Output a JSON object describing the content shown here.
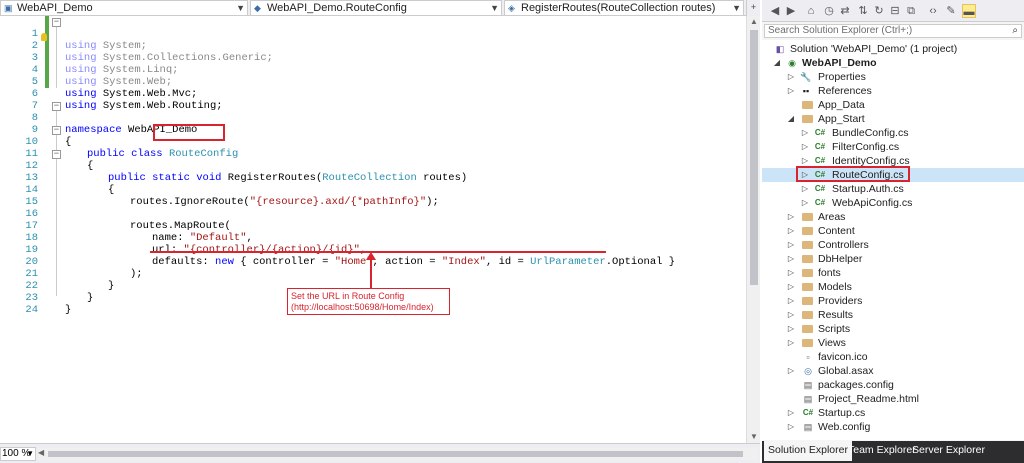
{
  "navbar": {
    "project": "WebAPI_Demo",
    "class": "WebAPI_Demo.RouteConfig",
    "member": "RegisterRoutes(RouteCollection routes)"
  },
  "code": {
    "lines": [
      {
        "n": "1"
      },
      {
        "n": "2"
      },
      {
        "n": "3"
      },
      {
        "n": "4"
      },
      {
        "n": "5"
      },
      {
        "n": "6"
      },
      {
        "n": "7"
      },
      {
        "n": "8"
      },
      {
        "n": "9"
      },
      {
        "n": "10"
      },
      {
        "n": "11"
      },
      {
        "n": "12"
      },
      {
        "n": "13"
      },
      {
        "n": "14"
      },
      {
        "n": "15"
      },
      {
        "n": "16"
      },
      {
        "n": "17"
      },
      {
        "n": "18"
      },
      {
        "n": "19"
      },
      {
        "n": "20"
      },
      {
        "n": "21"
      },
      {
        "n": "22"
      },
      {
        "n": "23"
      },
      {
        "n": "24"
      }
    ],
    "kw_using": "using",
    "ns1": "System;",
    "ns2": "System.Collections.Generic;",
    "ns3": "System.Linq;",
    "ns4": "System.Web;",
    "ns5": "System.Web.Mvc;",
    "ns6": "System.Web.Routing;",
    "kw_namespace": "namespace",
    "namespace_name": "WebAPI_Demo",
    "open_brace": "{",
    "close_brace": "}",
    "kw_public_class": "public class",
    "class_name": "RouteConfig",
    "kw_public_static_void": "public static void",
    "method_name": "RegisterRoutes(",
    "param_type": "RouteCollection",
    "param_rest": "routes)",
    "ignore_call": "routes.IgnoreRoute(",
    "ignore_arg": "\"{resource}.axd/{*pathInfo}\"",
    "ignore_end": ");",
    "maproute": "routes.MapRoute(",
    "name_key": "name: ",
    "name_val": "\"Default\"",
    "comma": ",",
    "url_key": "url: ",
    "url_val": "\"{controller}/{action}/{id}\"",
    "defaults_key": "defaults: ",
    "kw_new": "new",
    "defaults_a": " { controller = ",
    "ctrl_val": "\"Home\"",
    "defaults_b": ", action = ",
    "act_val": "\"Index\"",
    "defaults_c": ", id = ",
    "urlparam": "UrlParameter",
    "defaults_d": ".Optional }",
    "map_end": ");"
  },
  "annotation": {
    "line1": "Set the URL in Route Config",
    "line2": "(http://localhost:50698/Home/Index)"
  },
  "zoom": "100 %",
  "solution_explorer": {
    "search_placeholder": "Search Solution Explorer (Ctrl+;)",
    "solution": "Solution 'WebAPI_Demo' (1 project)",
    "project": "WebAPI_Demo",
    "items": {
      "properties": "Properties",
      "references": "References",
      "app_data": "App_Data",
      "app_start": "App_Start",
      "bundle": "BundleConfig.cs",
      "filter": "FilterConfig.cs",
      "identity": "IdentityConfig.cs",
      "route": "RouteConfig.cs",
      "startup_auth": "Startup.Auth.cs",
      "webapi": "WebApiConfig.cs",
      "areas": "Areas",
      "content": "Content",
      "controllers": "Controllers",
      "dbhelper": "DbHelper",
      "fonts": "fonts",
      "models": "Models",
      "providers": "Providers",
      "results": "Results",
      "scripts": "Scripts",
      "views": "Views",
      "favicon": "favicon.ico",
      "global": "Global.asax",
      "packages": "packages.config",
      "readme": "Project_Readme.html",
      "startup": "Startup.cs",
      "webconfig": "Web.config"
    },
    "tabs": {
      "solution_explorer": "Solution Explorer",
      "team_explorer": "Team Explorer",
      "server_explorer": "Server Explorer"
    }
  }
}
